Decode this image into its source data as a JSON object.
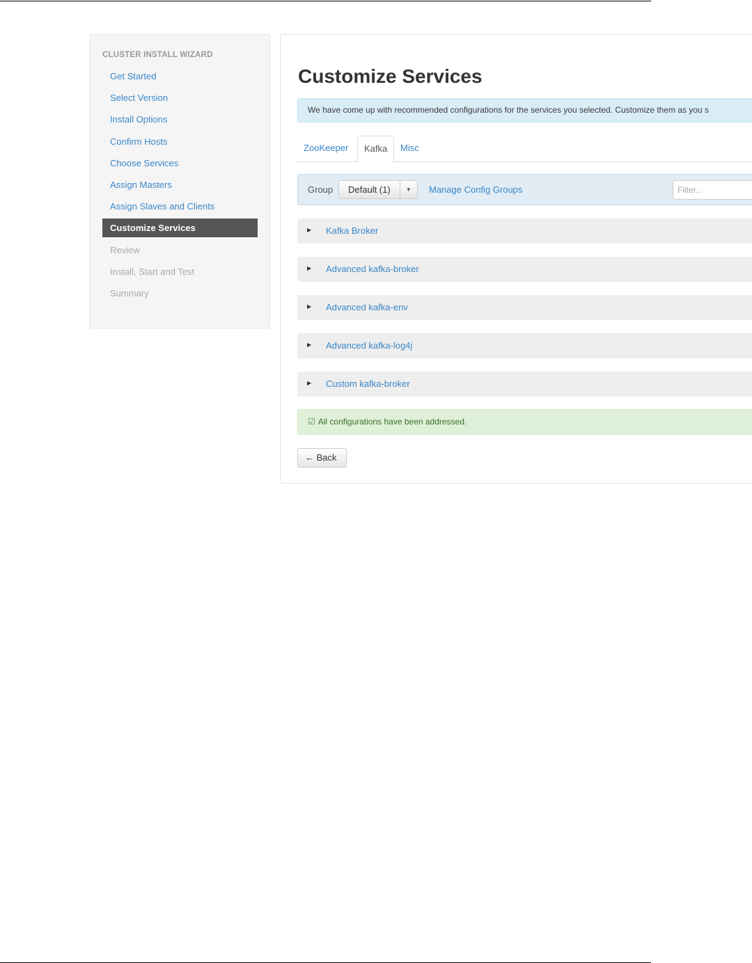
{
  "sidebar": {
    "header": "CLUSTER INSTALL WIZARD",
    "steps": [
      {
        "label": "Get Started",
        "state": "done"
      },
      {
        "label": "Select Version",
        "state": "done"
      },
      {
        "label": "Install Options",
        "state": "done"
      },
      {
        "label": "Confirm Hosts",
        "state": "done"
      },
      {
        "label": "Choose Services",
        "state": "done"
      },
      {
        "label": "Assign Masters",
        "state": "done"
      },
      {
        "label": "Assign Slaves and Clients",
        "state": "done"
      },
      {
        "label": "Customize Services",
        "state": "active"
      },
      {
        "label": "Review",
        "state": "todo"
      },
      {
        "label": "Install, Start and Test",
        "state": "todo"
      },
      {
        "label": "Summary",
        "state": "todo"
      }
    ]
  },
  "main": {
    "title": "Customize Services",
    "info_message": "We have come up with recommended configurations for the services you selected. Customize them as you s",
    "tabs": [
      {
        "label": "ZooKeeper",
        "active": false
      },
      {
        "label": "Kafka",
        "active": true
      },
      {
        "label": "Misc",
        "active": false
      }
    ],
    "group_bar": {
      "label": "Group",
      "selected": "Default (1)",
      "manage_link": "Manage Config Groups",
      "filter_placeholder": "Filter..."
    },
    "sections": [
      {
        "title": "Kafka Broker"
      },
      {
        "title": "Advanced kafka-broker"
      },
      {
        "title": "Advanced kafka-env"
      },
      {
        "title": "Advanced kafka-log4j"
      },
      {
        "title": "Custom kafka-broker"
      }
    ],
    "success_message": "All configurations have been addressed.",
    "back_label": "← Back"
  },
  "colors": {
    "link": "#3a87c8",
    "active_step_bg": "#555555",
    "info_bg": "#d9edf7",
    "success_bg": "#dff0d8",
    "section_bg": "#eeeeee"
  },
  "icons": {
    "section_toggle": "caret-right-icon",
    "dropdown": "caret-down-icon",
    "success": "check-square-icon"
  }
}
